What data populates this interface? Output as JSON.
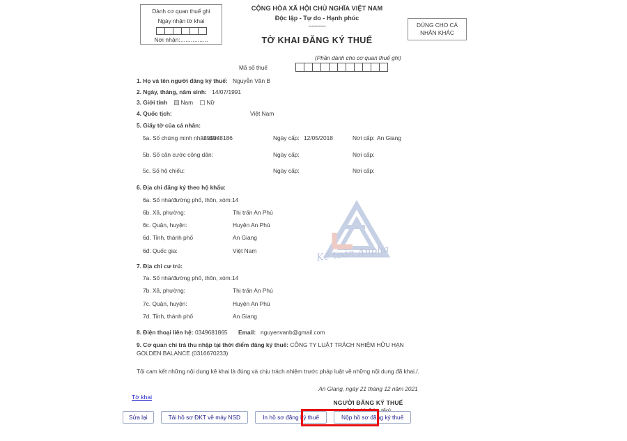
{
  "header": {
    "tax_office_box": {
      "line1": "Dành cơ quan thuế ghi",
      "line2": "Ngày nhận tờ khai",
      "received_cells": 6,
      "line4": "Nơi nhận:................"
    },
    "national": {
      "line1": "CỘNG HÒA XÃ HỘI CHỦ NGHĨA VIỆT NAM",
      "line2": "Độc lập - Tự do - Hạnh phúc",
      "divider": "----------",
      "title": "TỜ KHAI ĐĂNG KÝ THUẾ"
    },
    "other_person_box": {
      "line1": "DÙNG CHO CÁ",
      "line2": "NHÂN KHÁC"
    }
  },
  "tax_code": {
    "label": "Mã số thuế",
    "note": "(Phần dành cho cơ quan thuế ghi)",
    "cells": 11,
    "value": ""
  },
  "form": {
    "f1_label": "1. Họ và tên người đăng ký thuế:",
    "f1_value": "Nguyễn Văn B",
    "f2_label": "2. Ngày, tháng, năm sinh:",
    "f2_value": "14/07/1991",
    "f3_label": "3. Giới tính",
    "f3_male": "Nam",
    "f3_female": "Nữ",
    "f3_selected": "Nam",
    "f4_label": "4. Quốc tịch:",
    "f4_value": "Việt Nam",
    "f5_label": "5. Giấy tờ của cá nhân:",
    "documents": [
      {
        "label": "5a. Số chứng minh nhân dân:",
        "number": "291048186",
        "date_label": "Ngày cấp:",
        "date_value": "12/05/2018",
        "place_label": "Nơi cấp:",
        "place_value": "An Giang"
      },
      {
        "label": "5b. Số căn cước công dân:",
        "number": "",
        "date_label": "Ngày cấp:",
        "date_value": "",
        "place_label": "Nơi cấp:",
        "place_value": ""
      },
      {
        "label": "5c. Số hộ chiếu:",
        "number": "",
        "date_label": "Ngày cấp:",
        "date_value": "",
        "place_label": "Nơi cấp:",
        "place_value": ""
      }
    ],
    "f6_label": "6. Địa chỉ đăng ký theo hộ khẩu:",
    "f6_rows": [
      {
        "label": "6a. Số nhà/đường phố, thôn, xóm:",
        "value": "14",
        "inline": true
      },
      {
        "label": "6b. Xã, phường:",
        "value": "Thị trấn An Phú",
        "inline": false
      },
      {
        "label": "6c. Quận, huyện:",
        "value": "Huyện An Phú",
        "inline": false
      },
      {
        "label": "6d. Tỉnh, thành phố",
        "value": "An Giang",
        "inline": false
      },
      {
        "label": "6đ. Quốc gia:",
        "value": "Việt Nam",
        "inline": false
      }
    ],
    "f7_label": "7. Địa chỉ cư trú:",
    "f7_rows": [
      {
        "label": "7a. Số nhà/đường phố, thôn, xóm:",
        "value": "14",
        "inline": true
      },
      {
        "label": "7b. Xã, phường:",
        "value": "Thị trấn An Phú",
        "inline": false
      },
      {
        "label": "7c. Quận, huyện:",
        "value": "Huyện An Phú",
        "inline": false
      },
      {
        "label": "7d. Tỉnh, thành phố",
        "value": "An Giang",
        "inline": false
      }
    ],
    "f8_phone_label": "8. Điện thoại liên hệ:",
    "f8_phone_value": "0349681865",
    "f8_email_label": "Email:",
    "f8_email_value": "nguyenvanb@gmail.com",
    "f9_label": "9. Cơ quan chi trả thu nhập tại thời điểm đăng ký thuế:",
    "f9_value": "CÔNG TY LUẬT TRÁCH NHIỆM HỮU HẠN GOLDEN BALANCE  (0316670233)",
    "commitment": "Tôi cam kết những nội dung kê khai là đúng và chịu trách nhiệm trước pháp luật về những nội dung đã khai./.",
    "sign_date": "An Giang, ngày 21 tháng 12 năm 2021",
    "sign_title": "NGƯỜI ĐĂNG KÝ THUẾ",
    "sign_sub": "(Ký, ghi rõ họ tên)"
  },
  "watermark": {
    "text": "Kế toán Anpha",
    "logo_color": "#c5cfe4",
    "accent_color": "#efc5bd"
  },
  "bottom": {
    "declaration_link": "Tờ khai",
    "buttons": [
      {
        "label": "Sửa lại",
        "name": "edit-button",
        "highlighted": false
      },
      {
        "label": "Tải hồ sơ ĐKT về máy NSD",
        "name": "download-dossier-button",
        "highlighted": false
      },
      {
        "label": "In hồ sơ đăng ký thuế",
        "name": "print-dossier-button",
        "highlighted": false
      },
      {
        "label": "Nộp hồ sơ đăng ký thuế",
        "name": "submit-dossier-button",
        "highlighted": true
      }
    ],
    "highlight_color": "#e81010",
    "link_color": "#2222cc"
  }
}
